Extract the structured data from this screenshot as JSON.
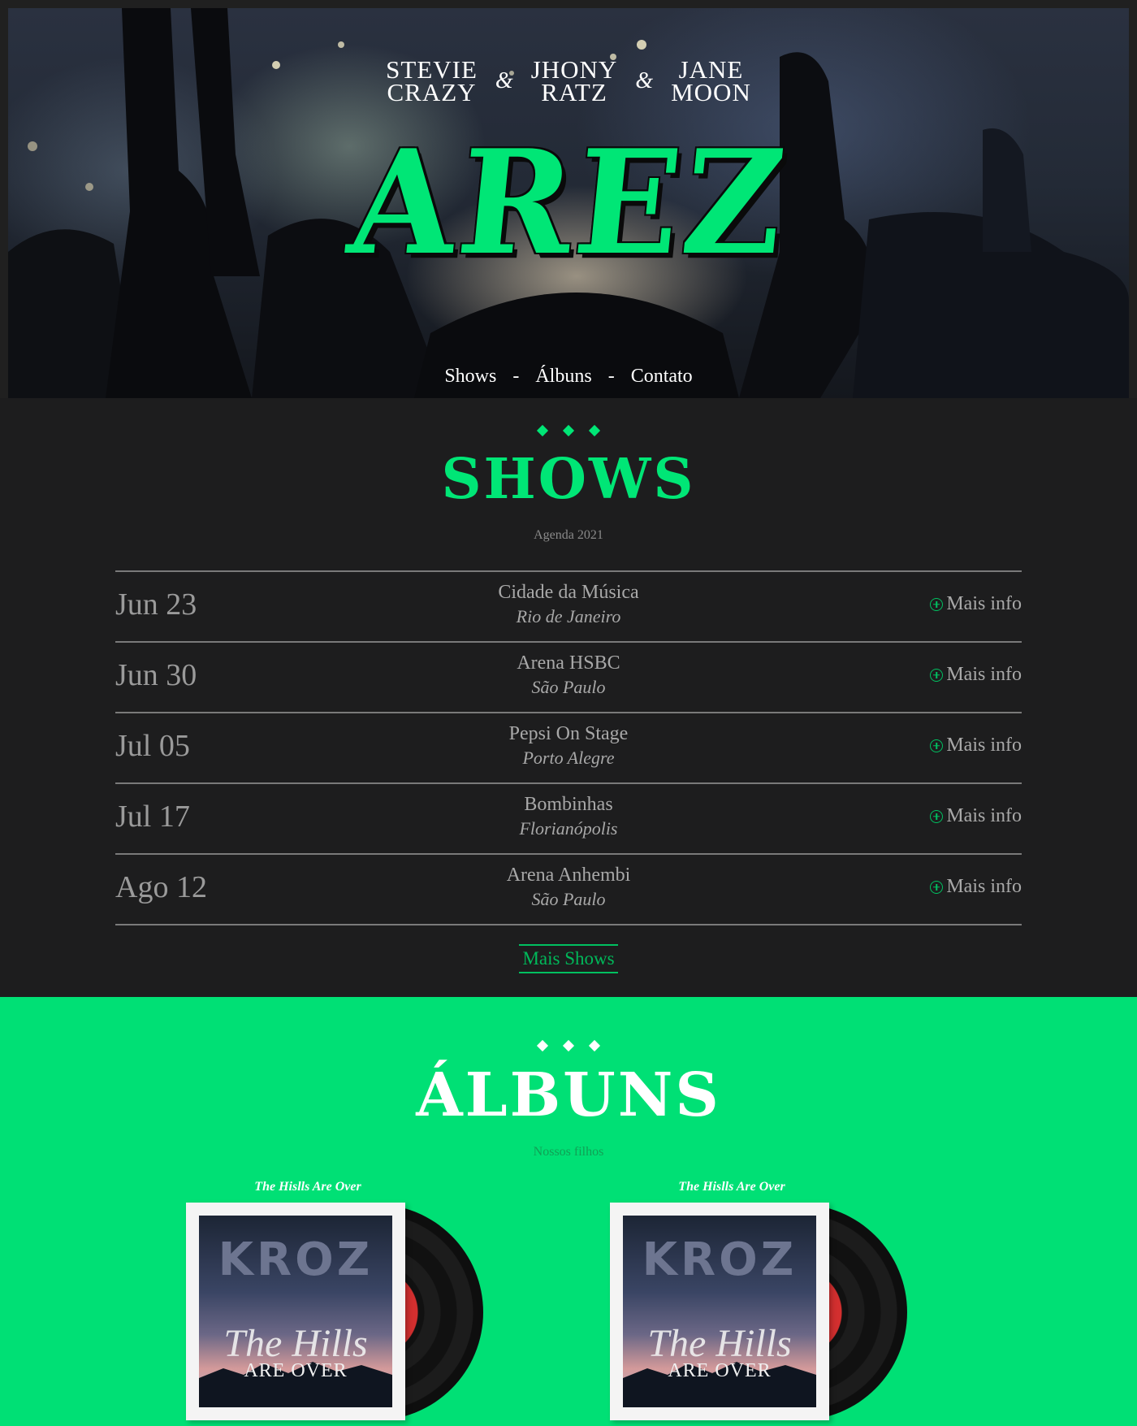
{
  "hero": {
    "members": [
      {
        "line1": "STEVIE",
        "line2": "CRAZY"
      },
      {
        "line1": "JHONY",
        "line2": "RATZ"
      },
      {
        "line1": "JANE",
        "line2": "MOON"
      }
    ],
    "ampersand": "&",
    "band_name": "AREZ",
    "nav": [
      "Shows",
      "Álbuns",
      "Contato"
    ],
    "nav_separator": "-"
  },
  "shows": {
    "title": "SHOWS",
    "subtitle": "Agenda 2021",
    "more_info_label": "Mais info",
    "items": [
      {
        "date": "Jun 23",
        "venue": "Cidade da Música",
        "city": "Rio de Janeiro"
      },
      {
        "date": "Jun 30",
        "venue": "Arena HSBC",
        "city": "São Paulo"
      },
      {
        "date": "Jul 05",
        "venue": "Pepsi On Stage",
        "city": "Porto Alegre"
      },
      {
        "date": "Jul 17",
        "venue": "Bombinhas",
        "city": "Florianópolis"
      },
      {
        "date": "Ago 12",
        "venue": "Arena Anhembi",
        "city": "São Paulo"
      }
    ],
    "more_shows_label": "Mais Shows"
  },
  "albums": {
    "title": "ÁLBUNS",
    "subtitle": "Nossos filhos",
    "items": [
      {
        "title": "The Hislls Are Over",
        "cover_band": "KROZ",
        "cover_title": "The Hills",
        "cover_subtitle": "ARE OVER"
      },
      {
        "title": "The Hislls Are Over",
        "cover_band": "KROZ",
        "cover_title": "The Hills",
        "cover_subtitle": "ARE OVER"
      }
    ]
  },
  "colors": {
    "accent": "#00e676",
    "background": "#1d1d1e",
    "albums_bg": "#00e075"
  },
  "icons": {
    "more_info": "plus-circle-icon",
    "section_divider": "diamond-icon"
  }
}
